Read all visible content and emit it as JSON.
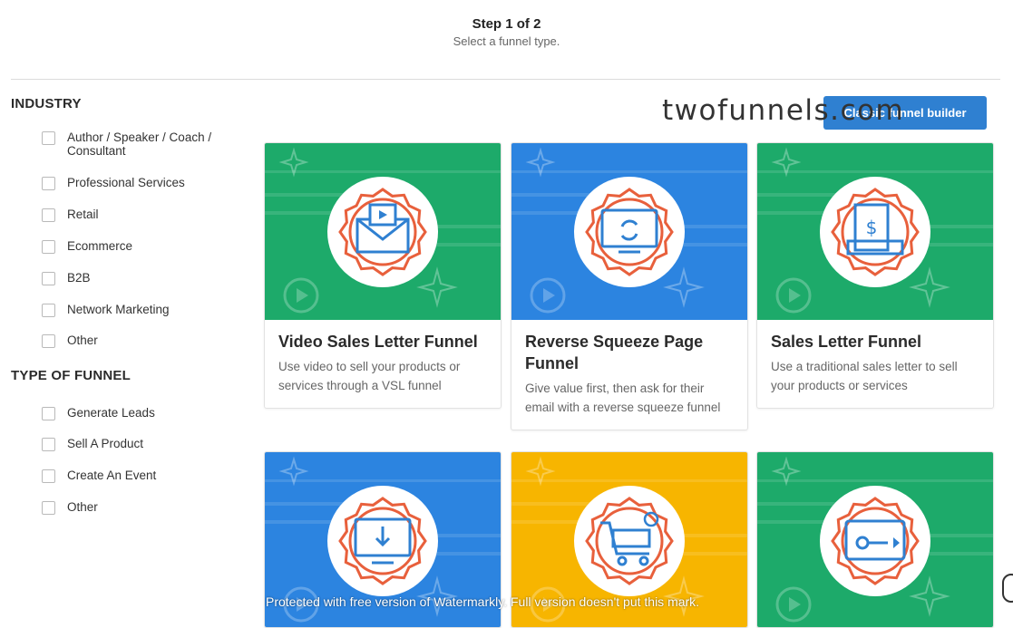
{
  "header": {
    "step": "Step 1 of 2",
    "subtitle": "Select a funnel type."
  },
  "sidebar": {
    "industry_title": "INDUSTRY",
    "industry": [
      "Author / Speaker / Coach / Consultant",
      "Professional Services",
      "Retail",
      "Ecommerce",
      "B2B",
      "Network Marketing",
      "Other"
    ],
    "type_title": "TYPE OF FUNNEL",
    "types": [
      "Generate Leads",
      "Sell A Product",
      "Create An Event",
      "Other"
    ]
  },
  "classic_button": "Classic funnel builder",
  "logo_watermark": "twofunnels.com",
  "cards": [
    {
      "title": "Video Sales Letter Funnel",
      "desc": "Use video to sell your products or services through a VSL funnel",
      "bg": "#1daa6a",
      "icon": "video-envelope-icon"
    },
    {
      "title": "Reverse Squeeze Page Funnel",
      "desc": "Give value first, then ask for their email with a reverse squeeze funnel",
      "bg": "#2c84e0",
      "icon": "monitor-refresh-icon"
    },
    {
      "title": "Sales Letter Funnel",
      "desc": "Use a traditional sales letter to sell your products or services",
      "bg": "#1daa6a",
      "icon": "sales-document-icon"
    },
    {
      "title": "",
      "desc": "",
      "bg": "#2c84e0",
      "icon": "monitor-download-icon"
    },
    {
      "title": "",
      "desc": "",
      "bg": "#f7b500",
      "icon": "shopping-cart-icon"
    },
    {
      "title": "",
      "desc": "",
      "bg": "#1daa6a",
      "icon": "card-key-icon"
    }
  ],
  "watermark_notice": "Protected with free version of Watermarkly. Full version doesn't put this mark."
}
